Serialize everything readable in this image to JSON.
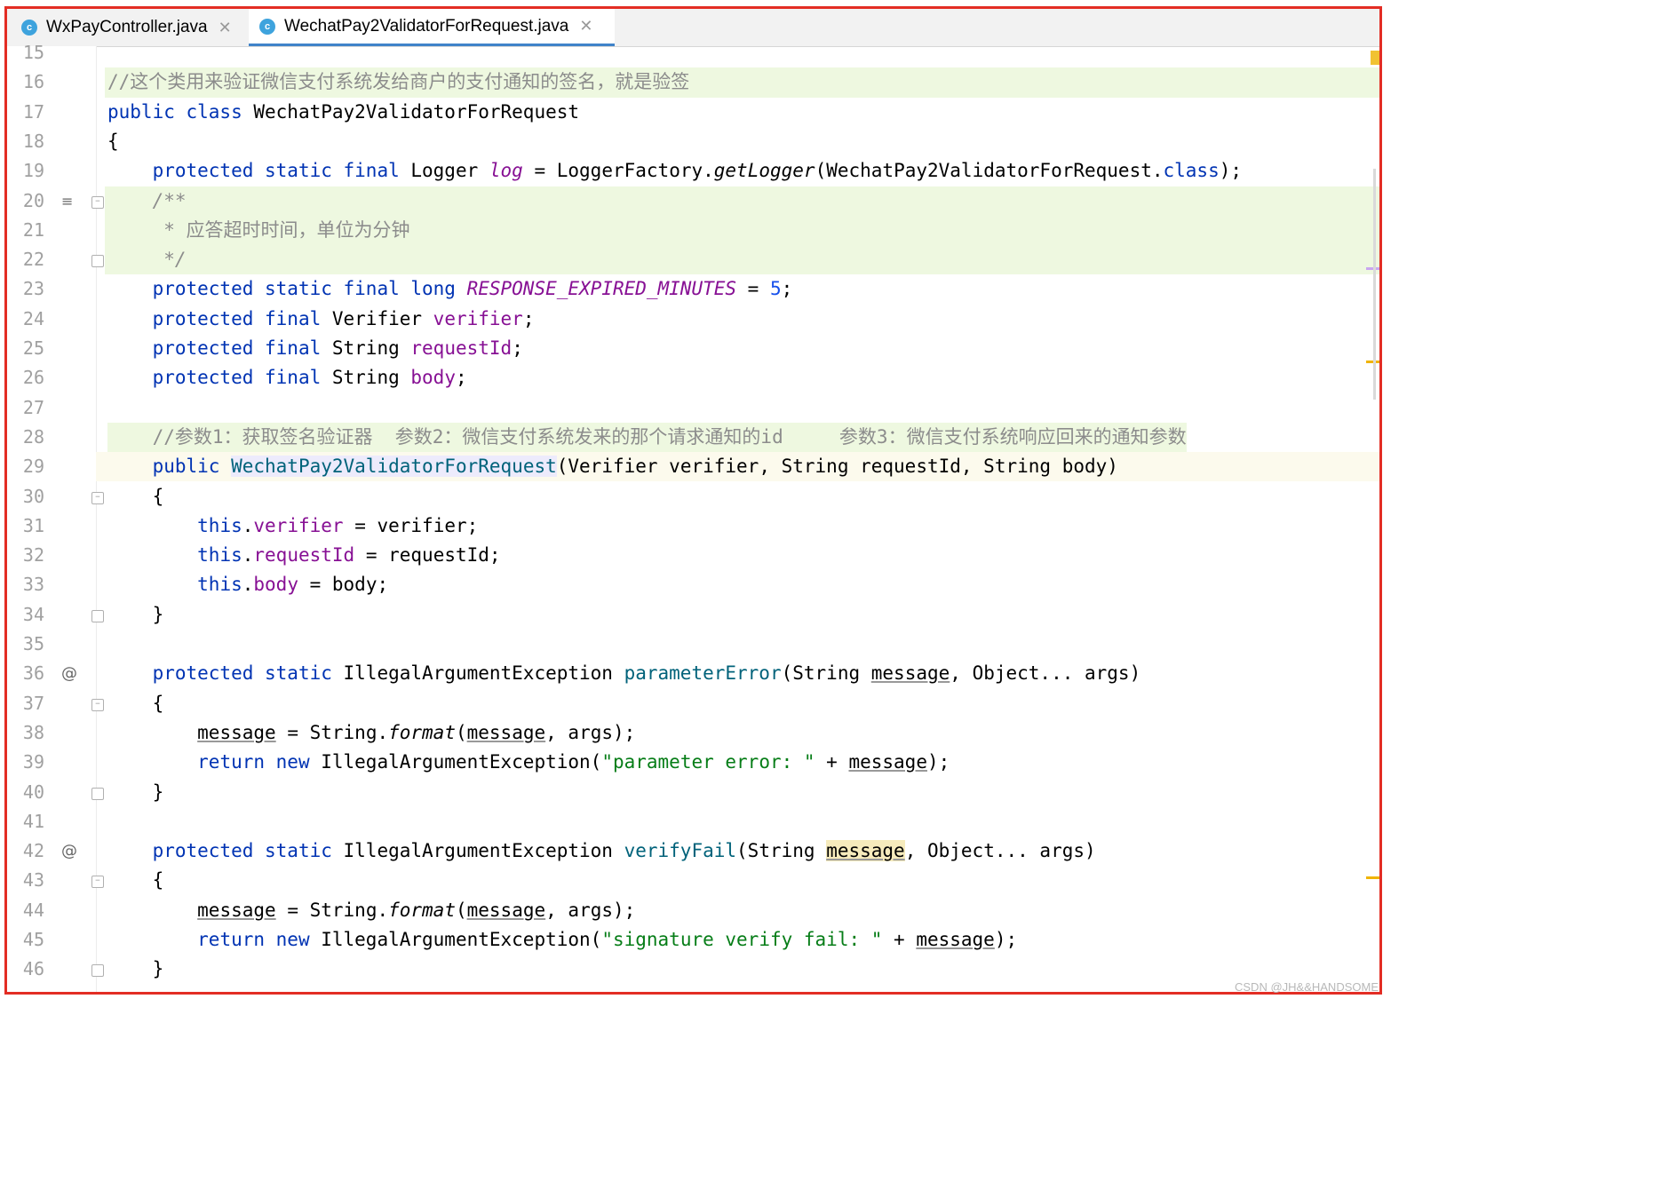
{
  "tabs": [
    {
      "label": "WxPayController.java",
      "icon": "class-icon",
      "active": false
    },
    {
      "label": "WechatPay2ValidatorForRequest.java",
      "icon": "class-icon",
      "active": true
    }
  ],
  "lines": [
    {
      "n": "15",
      "segs": []
    },
    {
      "n": "16",
      "bg": "green",
      "segs": [
        {
          "c": "cmt",
          "t": "//这个类用来验证微信支付系统发给商户的支付通知的签名，就是验签"
        }
      ]
    },
    {
      "n": "17",
      "segs": [
        {
          "c": "kw",
          "t": "public class "
        },
        {
          "c": "",
          "t": "WechatPay2ValidatorForRequest"
        }
      ]
    },
    {
      "n": "18",
      "segs": [
        {
          "c": "",
          "t": "{"
        }
      ]
    },
    {
      "n": "19",
      "segs": [
        {
          "c": "",
          "t": "    "
        },
        {
          "c": "kw",
          "t": "protected static final "
        },
        {
          "c": "",
          "t": "Logger "
        },
        {
          "c": "sfld",
          "t": "log"
        },
        {
          "c": "",
          "t": " = LoggerFactory."
        },
        {
          "c": "ital",
          "t": "getLogger"
        },
        {
          "c": "",
          "t": "(WechatPay2ValidatorForRequest."
        },
        {
          "c": "kw",
          "t": "class"
        },
        {
          "c": "",
          "t": ");"
        }
      ]
    },
    {
      "n": "20",
      "bg": "green",
      "fold": "open",
      "icon": "doc",
      "segs": [
        {
          "c": "",
          "t": "    "
        },
        {
          "c": "cmt ital",
          "t": "/**"
        }
      ]
    },
    {
      "n": "21",
      "bg": "green",
      "segs": [
        {
          "c": "",
          "t": "     "
        },
        {
          "c": "cmt",
          "t": "* 应答超时时间，单位为分钟"
        }
      ]
    },
    {
      "n": "22",
      "bg": "green",
      "fold": "close",
      "segs": [
        {
          "c": "",
          "t": "     "
        },
        {
          "c": "cmt ital",
          "t": "*/"
        }
      ]
    },
    {
      "n": "23",
      "segs": [
        {
          "c": "",
          "t": "    "
        },
        {
          "c": "kw",
          "t": "protected static final long "
        },
        {
          "c": "sfld",
          "t": "RESPONSE_EXPIRED_MINUTES"
        },
        {
          "c": "",
          "t": " = "
        },
        {
          "c": "num",
          "t": "5"
        },
        {
          "c": "",
          "t": ";"
        }
      ]
    },
    {
      "n": "24",
      "segs": [
        {
          "c": "",
          "t": "    "
        },
        {
          "c": "kw",
          "t": "protected final "
        },
        {
          "c": "",
          "t": "Verifier "
        },
        {
          "c": "fld",
          "t": "verifier"
        },
        {
          "c": "",
          "t": ";"
        }
      ]
    },
    {
      "n": "25",
      "segs": [
        {
          "c": "",
          "t": "    "
        },
        {
          "c": "kw",
          "t": "protected final "
        },
        {
          "c": "",
          "t": "String "
        },
        {
          "c": "fld",
          "t": "requestId"
        },
        {
          "c": "",
          "t": ";"
        }
      ]
    },
    {
      "n": "26",
      "segs": [
        {
          "c": "",
          "t": "    "
        },
        {
          "c": "kw",
          "t": "protected final "
        },
        {
          "c": "",
          "t": "String "
        },
        {
          "c": "fld",
          "t": "body"
        },
        {
          "c": "",
          "t": ";"
        }
      ]
    },
    {
      "n": "27",
      "segs": []
    },
    {
      "n": "28",
      "bg": "green-code",
      "segs": [
        {
          "c": "",
          "t": "    "
        },
        {
          "c": "cmt",
          "t": "//参数1：获取签名验证器  参数2：微信支付系统发来的那个请求通知的id     参数3：微信支付系统响应回来的通知参数"
        }
      ]
    },
    {
      "n": "29",
      "bg": "current",
      "segs": [
        {
          "c": "",
          "t": "    "
        },
        {
          "c": "kw",
          "t": "public "
        },
        {
          "c": "mth decl",
          "t": "WechatPay2ValidatorForRequest"
        },
        {
          "c": "",
          "t": "(Verifier verifier, String requestId, String body)"
        }
      ]
    },
    {
      "n": "30",
      "fold": "open",
      "segs": [
        {
          "c": "",
          "t": "    {"
        }
      ]
    },
    {
      "n": "31",
      "segs": [
        {
          "c": "",
          "t": "        "
        },
        {
          "c": "kw",
          "t": "this"
        },
        {
          "c": "",
          "t": "."
        },
        {
          "c": "fld",
          "t": "verifier"
        },
        {
          "c": "",
          "t": " = verifier;"
        }
      ]
    },
    {
      "n": "32",
      "segs": [
        {
          "c": "",
          "t": "        "
        },
        {
          "c": "kw",
          "t": "this"
        },
        {
          "c": "",
          "t": "."
        },
        {
          "c": "fld",
          "t": "requestId"
        },
        {
          "c": "",
          "t": " = requestId;"
        }
      ]
    },
    {
      "n": "33",
      "segs": [
        {
          "c": "",
          "t": "        "
        },
        {
          "c": "kw",
          "t": "this"
        },
        {
          "c": "",
          "t": "."
        },
        {
          "c": "fld",
          "t": "body"
        },
        {
          "c": "",
          "t": " = body;"
        }
      ]
    },
    {
      "n": "34",
      "fold": "close",
      "segs": [
        {
          "c": "",
          "t": "    }"
        }
      ]
    },
    {
      "n": "35",
      "segs": []
    },
    {
      "n": "36",
      "icon": "at",
      "segs": [
        {
          "c": "",
          "t": "    "
        },
        {
          "c": "kw",
          "t": "protected static "
        },
        {
          "c": "",
          "t": "IllegalArgumentException "
        },
        {
          "c": "mth",
          "t": "parameterError"
        },
        {
          "c": "",
          "t": "(String "
        },
        {
          "c": "u",
          "t": "message"
        },
        {
          "c": "",
          "t": ", Object... args)"
        }
      ]
    },
    {
      "n": "37",
      "fold": "open",
      "segs": [
        {
          "c": "",
          "t": "    {"
        }
      ]
    },
    {
      "n": "38",
      "segs": [
        {
          "c": "",
          "t": "        "
        },
        {
          "c": "u",
          "t": "message"
        },
        {
          "c": "",
          "t": " = String."
        },
        {
          "c": "ital",
          "t": "format"
        },
        {
          "c": "",
          "t": "("
        },
        {
          "c": "u",
          "t": "message"
        },
        {
          "c": "",
          "t": ", args);"
        }
      ]
    },
    {
      "n": "39",
      "segs": [
        {
          "c": "",
          "t": "        "
        },
        {
          "c": "kw",
          "t": "return new "
        },
        {
          "c": "",
          "t": "IllegalArgumentException("
        },
        {
          "c": "str",
          "t": "\"parameter error: \""
        },
        {
          "c": "",
          "t": " + "
        },
        {
          "c": "u",
          "t": "message"
        },
        {
          "c": "",
          "t": ");"
        }
      ]
    },
    {
      "n": "40",
      "fold": "close",
      "segs": [
        {
          "c": "",
          "t": "    }"
        }
      ]
    },
    {
      "n": "41",
      "segs": []
    },
    {
      "n": "42",
      "icon": "at",
      "segs": [
        {
          "c": "",
          "t": "    "
        },
        {
          "c": "kw",
          "t": "protected static "
        },
        {
          "c": "",
          "t": "IllegalArgumentException "
        },
        {
          "c": "mth",
          "t": "verifyFail"
        },
        {
          "c": "",
          "t": "(String "
        },
        {
          "c": "u warn-hl",
          "t": "message"
        },
        {
          "c": "",
          "t": ", Object... args)"
        }
      ]
    },
    {
      "n": "43",
      "fold": "open",
      "segs": [
        {
          "c": "",
          "t": "    {"
        }
      ]
    },
    {
      "n": "44",
      "segs": [
        {
          "c": "",
          "t": "        "
        },
        {
          "c": "u",
          "t": "message"
        },
        {
          "c": "",
          "t": " = String."
        },
        {
          "c": "ital",
          "t": "format"
        },
        {
          "c": "",
          "t": "("
        },
        {
          "c": "u",
          "t": "message"
        },
        {
          "c": "",
          "t": ", args);"
        }
      ]
    },
    {
      "n": "45",
      "segs": [
        {
          "c": "",
          "t": "        "
        },
        {
          "c": "kw",
          "t": "return new "
        },
        {
          "c": "",
          "t": "IllegalArgumentException("
        },
        {
          "c": "str",
          "t": "\"signature verify fail: \""
        },
        {
          "c": "",
          "t": " + "
        },
        {
          "c": "u",
          "t": "message"
        },
        {
          "c": "",
          "t": ");"
        }
      ]
    },
    {
      "n": "46",
      "fold": "close",
      "segs": [
        {
          "c": "",
          "t": "    }"
        }
      ]
    }
  ],
  "watermark": "CSDN @JH&&HANDSOME",
  "colors": {
    "border": "#e32d24",
    "keyword": "#0033b3",
    "field": "#871094",
    "string": "#067d17",
    "comment": "#8c8c8c",
    "tab_underline": "#4083c9"
  }
}
